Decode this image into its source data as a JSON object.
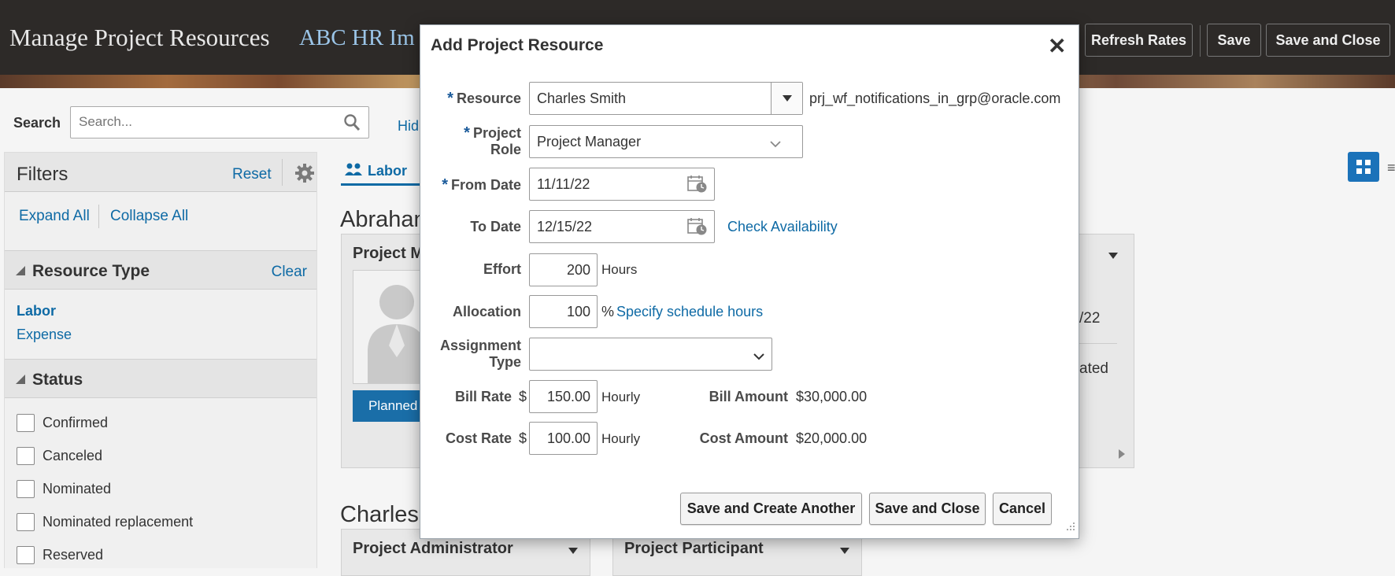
{
  "header": {
    "title": "Manage Project Resources",
    "subtitle": "ABC HR Im",
    "buttons": {
      "refresh_rates": "Refresh Rates",
      "save": "Save",
      "save_and_close": "Save and Close"
    }
  },
  "toolbar": {
    "search_label": "Search",
    "search_placeholder": "Search...",
    "hide_link": "Hid"
  },
  "filters": {
    "title": "Filters",
    "reset": "Reset",
    "expand_all": "Expand All",
    "collapse_all": "Collapse All",
    "resource_type": {
      "title": "Resource Type",
      "clear": "Clear",
      "items": [
        "Labor",
        "Expense"
      ]
    },
    "status": {
      "title": "Status",
      "items": [
        "Confirmed",
        "Canceled",
        "Nominated",
        "Nominated replacement",
        "Reserved"
      ]
    }
  },
  "main": {
    "tab_label": "Labor",
    "people": [
      {
        "name": "Abrahan",
        "cards": [
          {
            "title": "Project M",
            "button": "Planned",
            "fragments": [
              "/22",
              "ated"
            ]
          }
        ]
      },
      {
        "name": "Charles",
        "cards": [
          {
            "title": "Project Administrator"
          },
          {
            "title": "Project Participant"
          }
        ]
      }
    ]
  },
  "dialog": {
    "title": "Add Project Resource",
    "close_icon": "close-icon",
    "resource": {
      "label": "Resource",
      "value": "Charles Smith",
      "email": "prj_wf_notifications_in_grp@oracle.com"
    },
    "project_role": {
      "label_line1": "Project",
      "label_line2": "Role",
      "value": "Project Manager"
    },
    "from_date": {
      "label": "From Date",
      "value": "11/11/22"
    },
    "to_date": {
      "label": "To Date",
      "value": "12/15/22",
      "link": "Check Availability"
    },
    "effort": {
      "label": "Effort",
      "value": "200",
      "unit": "Hours"
    },
    "allocation": {
      "label": "Allocation",
      "value": "100",
      "unit": "%",
      "link": "Specify schedule hours"
    },
    "assignment_type": {
      "label_line1": "Assignment",
      "label_line2": "Type",
      "value": ""
    },
    "bill_rate": {
      "label": "Bill Rate",
      "currency": "$",
      "value": "150.00",
      "unit": "Hourly"
    },
    "bill_amount": {
      "label": "Bill Amount",
      "value": "$30,000.00"
    },
    "cost_rate": {
      "label": "Cost Rate",
      "currency": "$",
      "value": "100.00",
      "unit": "Hourly"
    },
    "cost_amount": {
      "label": "Cost Amount",
      "value": "$20,000.00"
    },
    "buttons": {
      "save_and_create_another": "Save and Create Another",
      "save_and_close": "Save and Close",
      "cancel": "Cancel"
    }
  },
  "colors": {
    "header_bg": "#2d2a28",
    "link": "#0e6aa5",
    "primary_button": "#1a6ea8",
    "required_marker": "#1a5a9a"
  }
}
